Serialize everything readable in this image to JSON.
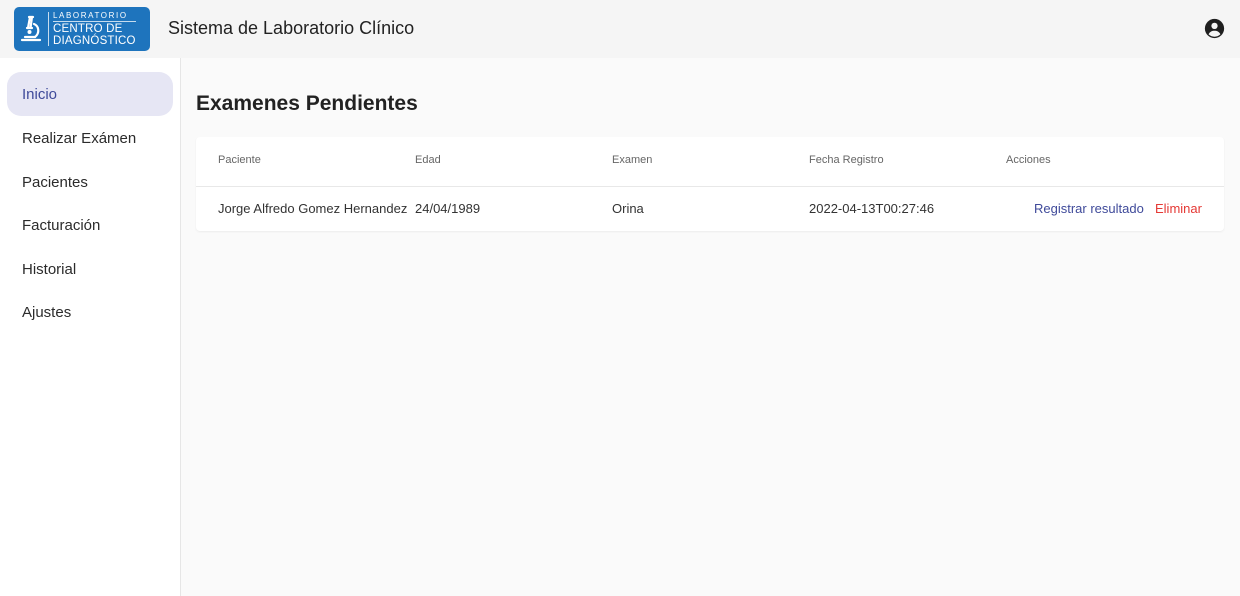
{
  "header": {
    "logo": {
      "line1": "LABORATORIO",
      "line2": "CENTRO DE",
      "line3": "DIAGNÓSTICO",
      "color": "#1e74bd",
      "emblem": "microscope-icon"
    },
    "title": "Sistema de Laboratorio Clínico",
    "account_icon": "account-circle-icon"
  },
  "sidebar": {
    "items": [
      {
        "label": "Inicio",
        "active": true
      },
      {
        "label": "Realizar Exámen",
        "active": false
      },
      {
        "label": "Pacientes",
        "active": false
      },
      {
        "label": "Facturación",
        "active": false
      },
      {
        "label": "Historial",
        "active": false
      },
      {
        "label": "Ajustes",
        "active": false
      }
    ]
  },
  "main": {
    "title": "Examenes Pendientes",
    "table": {
      "columns": [
        "Paciente",
        "Edad",
        "Examen",
        "Fecha Registro",
        "Acciones"
      ],
      "rows": [
        {
          "paciente": "Jorge Alfredo Gomez Hernandez",
          "edad": "24/04/1989",
          "examen": "Orina",
          "fecha": "2022-04-13T00:27:46",
          "actions": {
            "register": "Registrar resultado",
            "delete": "Eliminar"
          }
        }
      ]
    }
  },
  "colors": {
    "accent": "#3f4a9a",
    "active_nav_bg": "#e6e6f4",
    "danger": "#e53935"
  }
}
